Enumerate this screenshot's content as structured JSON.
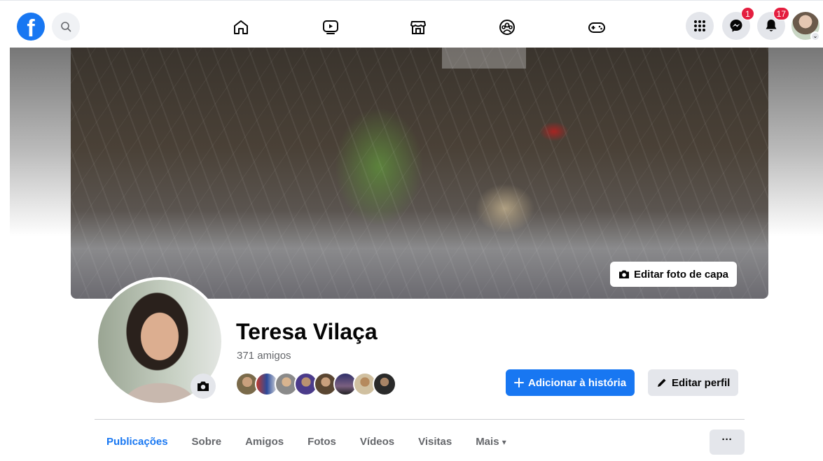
{
  "nav": {
    "badges": {
      "messenger": "1",
      "notifications": "17"
    },
    "accent": "#1877f2",
    "badge_color": "#e41e3f"
  },
  "cover": {
    "edit_button": "Editar foto de capa"
  },
  "profile": {
    "name": "Teresa Vilaça",
    "friends_count": "371 amigos",
    "add_story_button": "Adicionar à história",
    "edit_profile_button": "Editar perfil"
  },
  "tabs": [
    "Publicações",
    "Sobre",
    "Amigos",
    "Fotos",
    "Vídeos",
    "Visitas",
    "Mais"
  ],
  "tab_more_caret": "▾",
  "more_button": "···"
}
